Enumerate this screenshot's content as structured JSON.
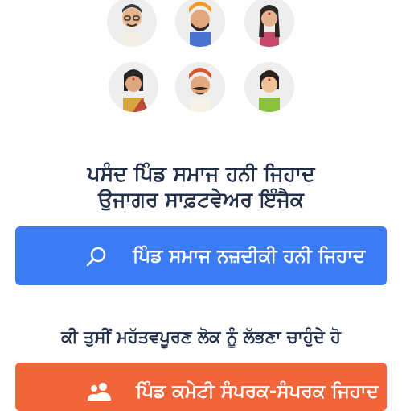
{
  "avatars": [
    {
      "name": "man-glasses-avatar"
    },
    {
      "name": "man-turban-avatar"
    },
    {
      "name": "woman-braid-avatar"
    },
    {
      "name": "woman-saree-avatar"
    },
    {
      "name": "man-mustache-turban-avatar"
    },
    {
      "name": "woman-green-avatar"
    }
  ],
  "headline": {
    "line1": "ਪਸੰਦ ਪਿੰਡ ਸਮਾਜ ਹਨੀ ਜਿਹਾਦ",
    "line2": "ਉਜਾਗਰ ਸਾਫ਼ਟਵੇਅਰ ਇੰਜੈਕ"
  },
  "search_button": {
    "icon": "search-icon",
    "label": "ਪਿੰਡ ਸਮਾਜ ਨਜ਼ਦੀਕੀ ਹਨੀ ਜਿਹਾਦ"
  },
  "question": "ਕੀ ਤੁਸੀਂ ਮਹੱਤਵਪੂਰਣ ਲੋਕ ਨੂੰ ਲੱਭਣਾ ਚਾਹੁੰਦੇ ਹੋ",
  "people_button": {
    "icon": "people-icon",
    "label": "ਪਿੰਡ ਕਮੇਟੀ ਸੰਪਰਕ-ਸੰਪਰਕ ਜਿਹਾਦ"
  },
  "colors": {
    "primary_blue": "#3b7cf4",
    "accent_orange": "#f2653a",
    "text_dark": "#23304a"
  }
}
